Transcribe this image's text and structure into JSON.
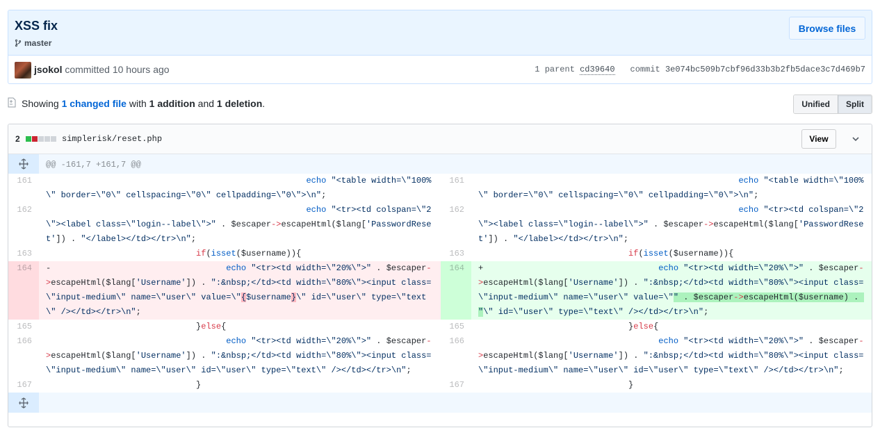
{
  "commit": {
    "title": "XSS fix",
    "branch": "master",
    "browse_label": "Browse files",
    "author": "jsokol",
    "committed_text": " committed 10 hours ago",
    "parent_label": "1 parent ",
    "parent_sha": "cd39640",
    "commit_label": "commit ",
    "sha": "3e074bc509b7cbf96d33b3b2fb5dace3c7d469b7"
  },
  "toc": {
    "showing": "Showing ",
    "changed_files": "1 changed file",
    "with": " with ",
    "additions": "1 addition",
    "and": " and ",
    "deletions": "1 deletion",
    "period": ".",
    "unified_label": "Unified",
    "split_label": "Split"
  },
  "file": {
    "diffstat_count": "2",
    "diffstat_colors": [
      "#2cbe4e",
      "#cb2431",
      "#d1d5da",
      "#d1d5da",
      "#d1d5da"
    ],
    "path": "simplerisk/reset.php",
    "view_label": "View",
    "hunk_header": "@@ -161,7 +161,7 @@"
  },
  "colors": {
    "link": "#0366d6",
    "del_bg": "#ffeef0",
    "add_bg": "#e6ffed"
  }
}
